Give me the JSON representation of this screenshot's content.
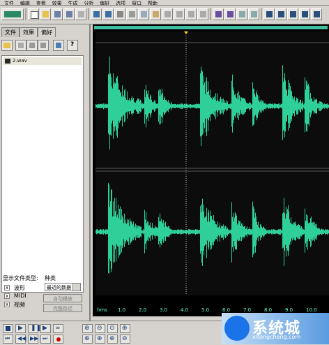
{
  "menu": [
    "文件",
    "编辑",
    "查看",
    "效果",
    "生成",
    "分析",
    "偏好",
    "选项",
    "窗口",
    "帮助"
  ],
  "left_panel": {
    "tabs": [
      "文件",
      "效果",
      "偏好"
    ],
    "files": [
      "2.wav"
    ],
    "file_type_label": "显示文件类型:",
    "sort_label": "种类",
    "types": [
      {
        "label": "波形",
        "checked": "x"
      },
      {
        "label": "MIDI",
        "checked": "x"
      },
      {
        "label": "视频",
        "checked": "x"
      }
    ],
    "sort_value": "最近的数据",
    "auto_play": "自动播放",
    "full_path": "完整路径"
  },
  "timeline": {
    "labels": [
      "hms",
      "1.0",
      "2.0",
      "3.0",
      "4.0",
      "5.0",
      "6.0",
      "7.0",
      "8.0",
      "9.0",
      "10.0"
    ]
  },
  "watermark": {
    "title": "系统城",
    "url": "xitongcheng.com"
  },
  "colors": {
    "waveform": "#2fcf9a",
    "background": "#0c0c0c",
    "chrome": "#d6d3ce",
    "cursor": "#ffd700"
  }
}
